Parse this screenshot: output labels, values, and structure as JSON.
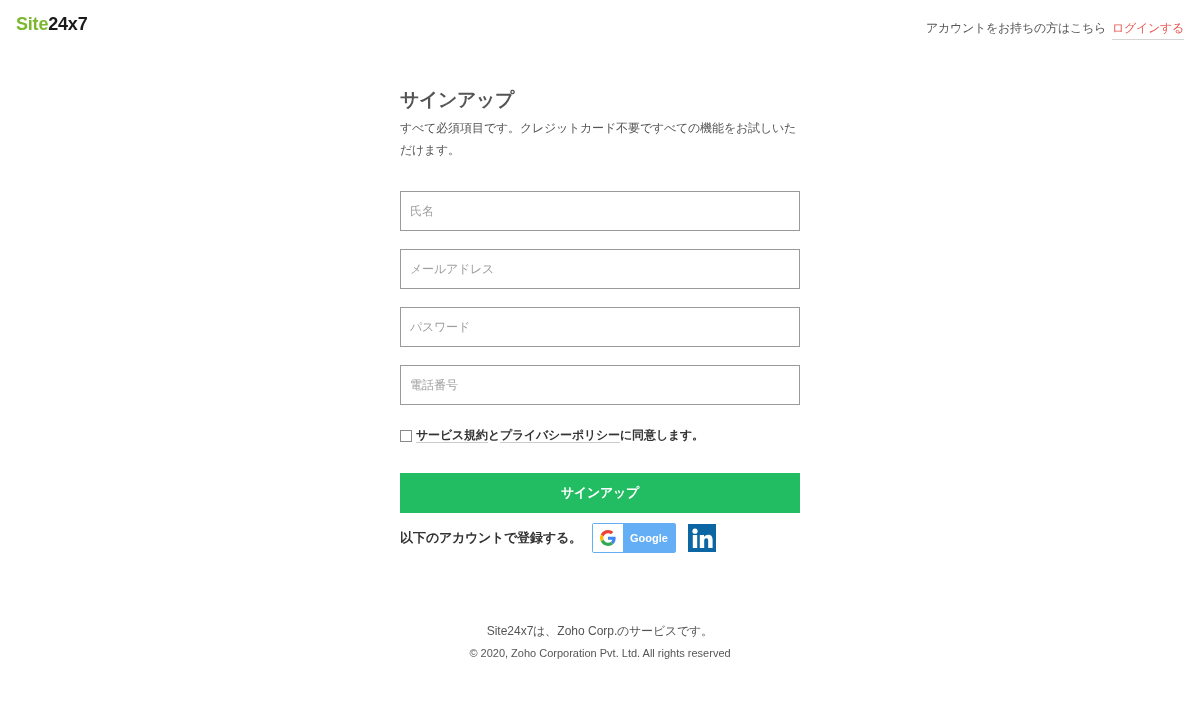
{
  "header": {
    "logo": [
      {
        "text": "Site",
        "color": "#7cb82f"
      },
      {
        "text": "24x7",
        "color": "#1a1a1a"
      }
    ],
    "account_prompt": "アカウントをお持ちの方はこちら",
    "login_link": "ログインする"
  },
  "signup": {
    "title": "サインアップ",
    "description": "すべて必須項目です。クレジットカード不要ですべての機能をお試しいただけます。",
    "fields": [
      {
        "placeholder": "氏名"
      },
      {
        "placeholder": "メールアドレス"
      },
      {
        "placeholder": "パスワード"
      },
      {
        "placeholder": "電話番号"
      }
    ],
    "consent": {
      "checked": false,
      "terms_link": "サービス規約",
      "conjunction": "と",
      "privacy_link": "プライバシーポリシー",
      "suffix": "に同意します。"
    },
    "submit_button": "サインアップ",
    "social": {
      "label": "以下のアカウントで登録する。",
      "providers": [
        {
          "kind": "google",
          "label": "Google"
        },
        {
          "kind": "linkedin"
        }
      ]
    }
  },
  "footer": {
    "service_note": "Site24x7は、Zoho Corp.のサービスです。",
    "copyright": "© 2020, Zoho Corporation Pvt. Ltd. All rights reserved"
  }
}
